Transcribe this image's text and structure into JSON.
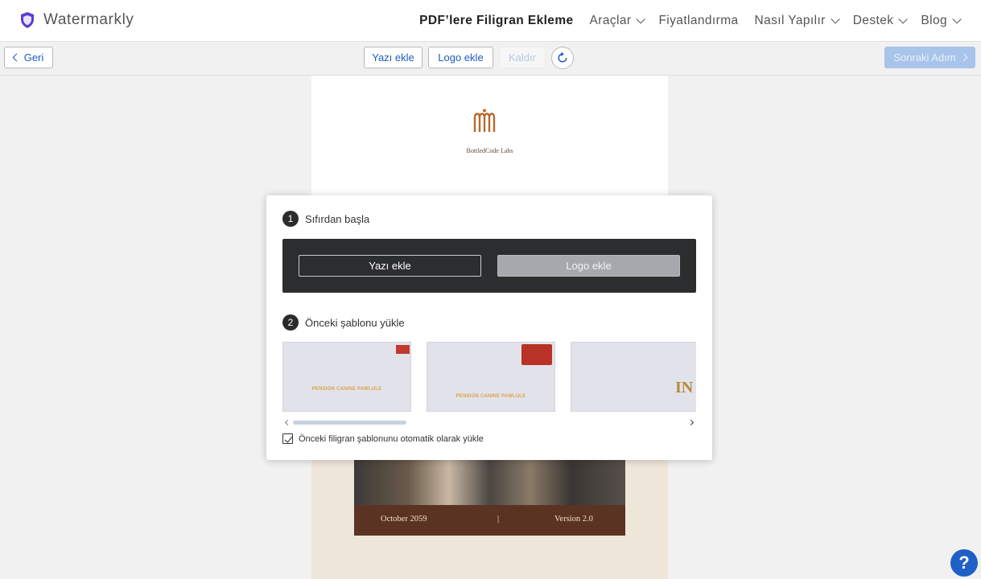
{
  "brand": {
    "name": "Watermarkly",
    "icon": "shield-icon",
    "color": "#5b3ccf"
  },
  "nav": {
    "items": [
      {
        "label": "PDF’lere Filigran Ekleme",
        "active": true,
        "dropdown": false
      },
      {
        "label": "Araçlar",
        "dropdown": true
      },
      {
        "label": "Fiyatlandırma",
        "dropdown": false
      },
      {
        "label": "Nasıl Yapılır",
        "dropdown": true
      },
      {
        "label": "Destek",
        "dropdown": true
      },
      {
        "label": "Blog",
        "dropdown": true
      }
    ]
  },
  "toolbar": {
    "back_label": "Geri",
    "add_text_label": "Yazı ekle",
    "add_logo_label": "Logo ekle",
    "remove_label": "Kaldır",
    "next_label": "Sonraki Adım",
    "accent_color": "#1d5cc2"
  },
  "document": {
    "company_name": "BottledCode Labs",
    "footer_date": "October 2059",
    "footer_separator": "|",
    "footer_version": "Version 2.0"
  },
  "modal": {
    "step1": {
      "number": "1",
      "title": "Sıfırdan başla"
    },
    "start_text_button": "Yazı ekle",
    "start_logo_button": "Logo ekle",
    "step2": {
      "number": "2",
      "title": "Önceki şablonu yükle"
    },
    "templates": [
      {
        "text": "PENSION CANINE PAWLULE",
        "logo": "small"
      },
      {
        "text": "PENSION CANINE PAWLULE",
        "logo": "large"
      },
      {
        "text": "IN",
        "logo": "none"
      }
    ],
    "auto_load_label": "Önceki filigran şablonunu otomatik olarak yükle",
    "auto_load_checked": true
  },
  "help": {
    "label": "?"
  }
}
